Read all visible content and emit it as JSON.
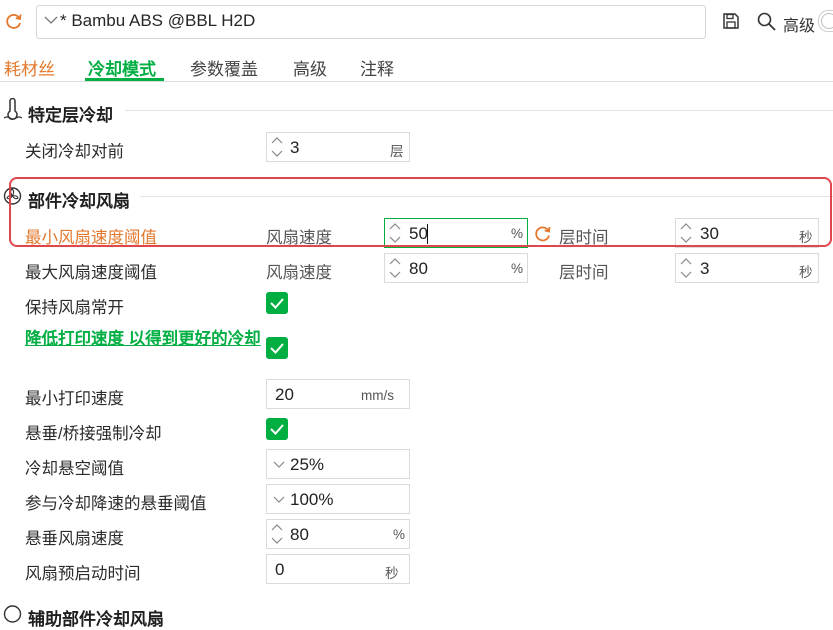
{
  "topbar": {
    "preset_name": "* Bambu ABS @BBL H2D",
    "advanced_label": "高级"
  },
  "tabs": [
    {
      "label": "耗材丝"
    },
    {
      "label": "冷却模式"
    },
    {
      "label": "参数覆盖"
    },
    {
      "label": "高级"
    },
    {
      "label": "注释"
    }
  ],
  "sections": {
    "layer_cooling": {
      "title": "特定层冷却",
      "close_cooling_before": {
        "label": "关闭冷却对前",
        "value": "3",
        "unit": "层"
      }
    },
    "part_fan": {
      "title": "部件冷却风扇",
      "min_fan": {
        "label": "最小风扇速度阈值",
        "speed_label": "风扇速度",
        "speed_value": "50",
        "speed_unit": "%",
        "time_label": "层时间",
        "time_value": "30",
        "time_unit": "秒"
      },
      "max_fan": {
        "label": "最大风扇速度阈值",
        "speed_label": "风扇速度",
        "speed_value": "80",
        "speed_unit": "%",
        "time_label": "层时间",
        "time_value": "3",
        "time_unit": "秒"
      },
      "keep_fan_on": {
        "label": "保持风扇常开",
        "checked": true
      },
      "slow_down": {
        "label": "降低打印速度 以得到更好的冷却",
        "checked": true
      },
      "min_print_speed": {
        "label": "最小打印速度",
        "value": "20",
        "unit": "mm/s"
      },
      "overhang_force": {
        "label": "悬垂/桥接强制冷却",
        "checked": true
      },
      "overhang_threshold": {
        "label": "冷却悬空阈值",
        "value": "25%"
      },
      "overhang_slow": {
        "label": "参与冷却降速的悬垂阈值",
        "value": "100%"
      },
      "overhang_fan": {
        "label": "悬垂风扇速度",
        "value": "80",
        "unit": "%"
      },
      "fan_kickstart": {
        "label": "风扇预启动时间",
        "value": "0",
        "unit": "秒"
      }
    },
    "aux_fan": {
      "title": "辅助部件冷却风扇"
    }
  },
  "colors": {
    "accent": "#00ae42",
    "modified": "#e3782d",
    "highlight": "#e0474c"
  }
}
